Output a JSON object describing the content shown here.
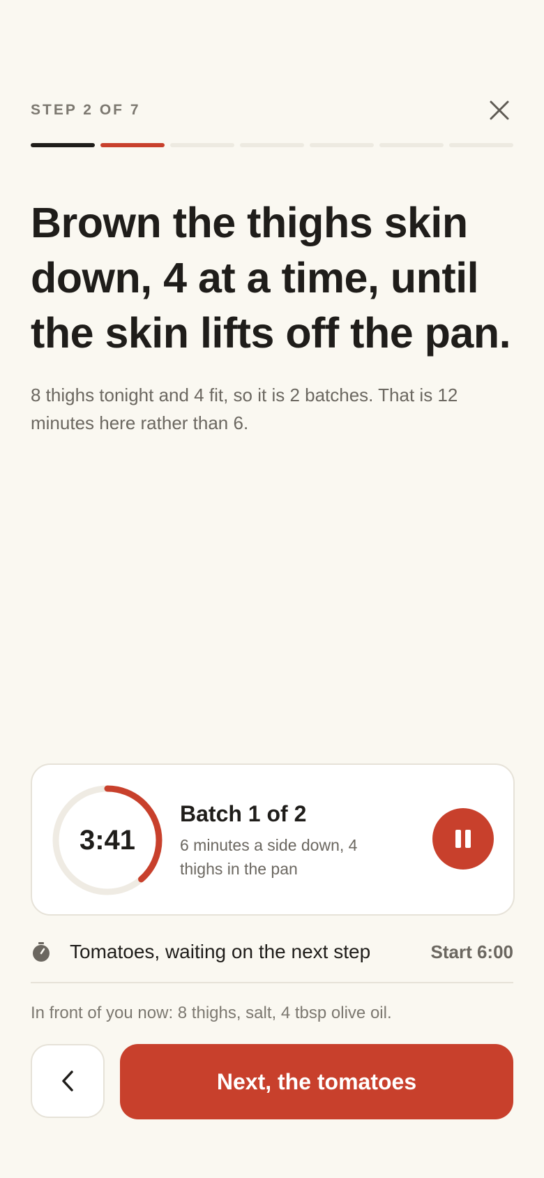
{
  "header": {
    "step_label": "STEP 2 OF 7",
    "total_steps": 7,
    "current_step": 2
  },
  "step": {
    "title": "Brown the thighs skin down, 4 at a time, until the skin lifts off the pan.",
    "note": "8 thighs tonight and 4 fit, so it is 2 batches. That is 12 minutes here rather than 6."
  },
  "timer": {
    "time_remaining": "3:41",
    "elapsed_fraction": 0.386,
    "batch_title": "Batch 1 of 2",
    "batch_description": "6 minutes a side down, 4 thighs in the pan"
  },
  "upcoming": {
    "label": "Tomatoes, waiting on the next step",
    "start": "Start 6:00"
  },
  "in_front": "In front of you now: 8 thighs, salt, 4 tbsp olive oil.",
  "actions": {
    "next_label": "Next, the tomatoes"
  },
  "colors": {
    "accent": "#c8402c",
    "background": "#faf8f1",
    "text": "#1f1d1a",
    "muted": "#6b6760",
    "track": "#efebe3"
  },
  "icons": {
    "close": "close-icon",
    "pause": "pause-icon",
    "stopwatch": "stopwatch-icon",
    "back": "chevron-left-icon"
  }
}
